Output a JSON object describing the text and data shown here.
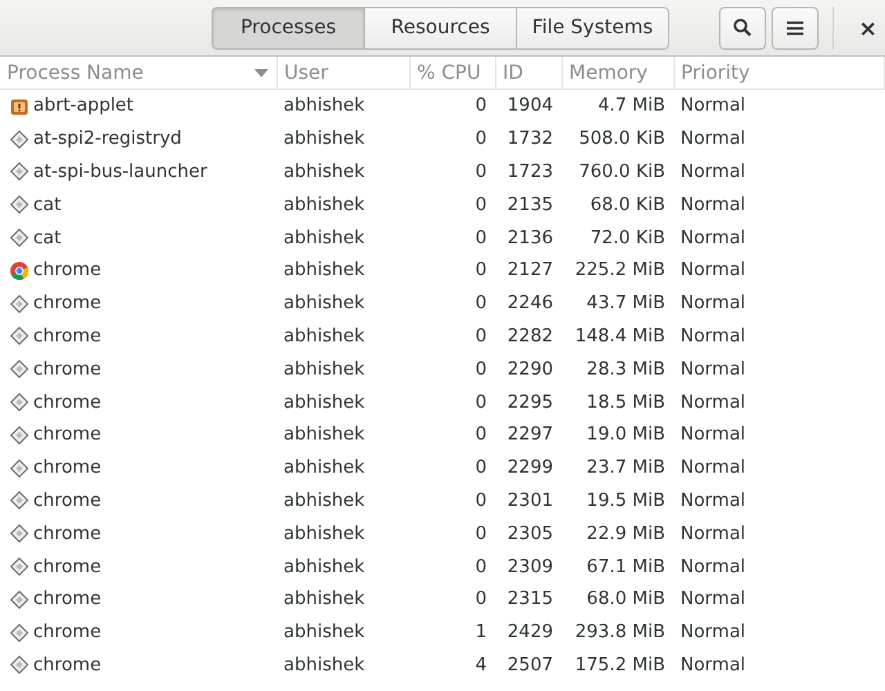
{
  "tabs": [
    {
      "label": "Processes",
      "selected": true
    },
    {
      "label": "Resources",
      "selected": false
    },
    {
      "label": "File Systems",
      "selected": false
    }
  ],
  "header_buttons": [
    "×"
  ],
  "table": {
    "columns": [
      {
        "label": "Process Name",
        "sorted": true
      },
      {
        "label": "User",
        "sorted": false
      },
      {
        "label": "% CPU",
        "sorted": false
      },
      {
        "label": "ID",
        "sorted": false
      },
      {
        "label": "Memory",
        "sorted": false
      },
      {
        "label": "Priority",
        "sorted": false
      }
    ],
    "rows": [
      {
        "kind": "alert",
        "name": "abrt-applet",
        "user": "abhishek",
        "cpu": "0",
        "id": "1904",
        "memory": "4.7 MiB",
        "priority": "Normal"
      },
      {
        "kind": "generic",
        "name": "at-spi2-registryd",
        "user": "abhishek",
        "cpu": "0",
        "id": "1732",
        "memory": "508.0 KiB",
        "priority": "Normal"
      },
      {
        "kind": "generic",
        "name": "at-spi-bus-launcher",
        "user": "abhishek",
        "cpu": "0",
        "id": "1723",
        "memory": "760.0 KiB",
        "priority": "Normal"
      },
      {
        "kind": "generic",
        "name": "cat",
        "user": "abhishek",
        "cpu": "0",
        "id": "2135",
        "memory": "68.0 KiB",
        "priority": "Normal"
      },
      {
        "kind": "generic",
        "name": "cat",
        "user": "abhishek",
        "cpu": "0",
        "id": "2136",
        "memory": "72.0 KiB",
        "priority": "Normal"
      },
      {
        "kind": "chrome",
        "name": "chrome",
        "user": "abhishek",
        "cpu": "0",
        "id": "2127",
        "memory": "225.2 MiB",
        "priority": "Normal"
      },
      {
        "kind": "generic",
        "name": "chrome",
        "user": "abhishek",
        "cpu": "0",
        "id": "2246",
        "memory": "43.7 MiB",
        "priority": "Normal"
      },
      {
        "kind": "generic",
        "name": "chrome",
        "user": "abhishek",
        "cpu": "0",
        "id": "2282",
        "memory": "148.4 MiB",
        "priority": "Normal"
      },
      {
        "kind": "generic",
        "name": "chrome",
        "user": "abhishek",
        "cpu": "0",
        "id": "2290",
        "memory": "28.3 MiB",
        "priority": "Normal"
      },
      {
        "kind": "generic",
        "name": "chrome",
        "user": "abhishek",
        "cpu": "0",
        "id": "2295",
        "memory": "18.5 MiB",
        "priority": "Normal"
      },
      {
        "kind": "generic",
        "name": "chrome",
        "user": "abhishek",
        "cpu": "0",
        "id": "2297",
        "memory": "19.0 MiB",
        "priority": "Normal"
      },
      {
        "kind": "generic",
        "name": "chrome",
        "user": "abhishek",
        "cpu": "0",
        "id": "2299",
        "memory": "23.7 MiB",
        "priority": "Normal"
      },
      {
        "kind": "generic",
        "name": "chrome",
        "user": "abhishek",
        "cpu": "0",
        "id": "2301",
        "memory": "19.5 MiB",
        "priority": "Normal"
      },
      {
        "kind": "generic",
        "name": "chrome",
        "user": "abhishek",
        "cpu": "0",
        "id": "2305",
        "memory": "22.9 MiB",
        "priority": "Normal"
      },
      {
        "kind": "generic",
        "name": "chrome",
        "user": "abhishek",
        "cpu": "0",
        "id": "2309",
        "memory": "67.1 MiB",
        "priority": "Normal"
      },
      {
        "kind": "generic",
        "name": "chrome",
        "user": "abhishek",
        "cpu": "0",
        "id": "2315",
        "memory": "68.0 MiB",
        "priority": "Normal"
      },
      {
        "kind": "generic",
        "name": "chrome",
        "user": "abhishek",
        "cpu": "1",
        "id": "2429",
        "memory": "293.8 MiB",
        "priority": "Normal"
      },
      {
        "kind": "generic",
        "name": "chrome",
        "user": "abhishek",
        "cpu": "4",
        "id": "2507",
        "memory": "175.2 MiB",
        "priority": "Normal"
      }
    ]
  }
}
